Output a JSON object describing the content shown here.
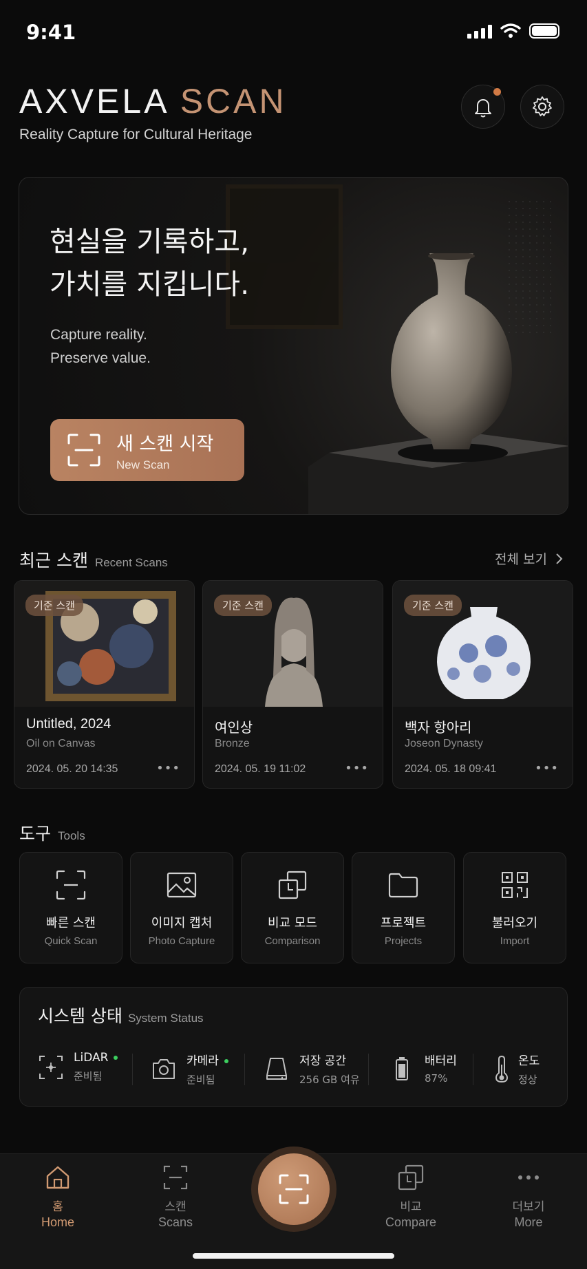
{
  "status_bar": {
    "time": "9:41"
  },
  "header": {
    "brand_main": "AXVELA",
    "brand_accent": "SCAN",
    "tagline": "Reality Capture for Cultural Heritage",
    "icons": [
      "bell-icon",
      "gear-icon"
    ],
    "accent_color": "#c49373"
  },
  "hero": {
    "title_line1": "현실을 기록하고,",
    "title_line2": "가치를 지킵니다.",
    "subtitle_line1": "Capture reality.",
    "subtitle_line2": "Preserve value.",
    "button_ko": "새 스캔 시작",
    "button_en": "New Scan"
  },
  "recent": {
    "title": "최근 스캔",
    "title_en": "Recent Scans",
    "see_all": "전체 보기",
    "items": [
      {
        "badge": "기준 스캔",
        "title": "Untitled, 2024",
        "subtitle": "Oil on Canvas",
        "date": "2024. 05. 20  14:35",
        "more": "•••"
      },
      {
        "badge": "기준 스캔",
        "title": "여인상",
        "subtitle": "Bronze",
        "date": "2024. 05. 19  11:02",
        "more": "•••"
      },
      {
        "badge": "기준 스캔",
        "title": "백자 항아리",
        "subtitle": "Joseon Dynasty",
        "date": "2024. 05. 18  09:41",
        "more": "•••"
      }
    ]
  },
  "tools": {
    "title": "도구",
    "title_en": "Tools",
    "items": [
      {
        "ko": "빠른 스캔",
        "en": "Quick Scan",
        "icon": "scan-frame-icon"
      },
      {
        "ko": "이미지 캡처",
        "en": "Photo Capture",
        "icon": "image-icon"
      },
      {
        "ko": "비교 모드",
        "en": "Comparison",
        "icon": "compare-icon"
      },
      {
        "ko": "프로젝트",
        "en": "Projects",
        "icon": "folder-icon"
      },
      {
        "ko": "불러오기",
        "en": "Import",
        "icon": "qr-import-icon"
      }
    ]
  },
  "system": {
    "title": "시스템 상태",
    "title_en": "System Status",
    "items": [
      {
        "name": "LiDAR",
        "value": "준비됨",
        "icon": "lidar-icon",
        "ready": true
      },
      {
        "name": "카메라",
        "value": "준비됨",
        "icon": "camera-icon",
        "ready": true
      },
      {
        "name": "저장 공간",
        "value": "256 GB 여유",
        "icon": "storage-icon",
        "ready": false
      },
      {
        "name": "배터리",
        "value": "87%",
        "icon": "battery-icon",
        "ready": false
      },
      {
        "name": "온도",
        "value": "정상",
        "icon": "thermometer-icon",
        "ready": false
      }
    ],
    "ready_color": "#3ccf5f"
  },
  "tabbar": {
    "items": [
      {
        "ko": "홈",
        "en": "Home",
        "icon": "home-icon",
        "active": true
      },
      {
        "ko": "스캔",
        "en": "Scans",
        "icon": "scan-frame-icon",
        "active": false
      },
      {
        "ko": "비교",
        "en": "Compare",
        "icon": "compare-icon",
        "active": false
      },
      {
        "ko": "더보기",
        "en": "More",
        "icon": "more-icon",
        "active": false
      }
    ],
    "center_icon": "scan-frame-icon",
    "active_color": "#d19a72"
  }
}
